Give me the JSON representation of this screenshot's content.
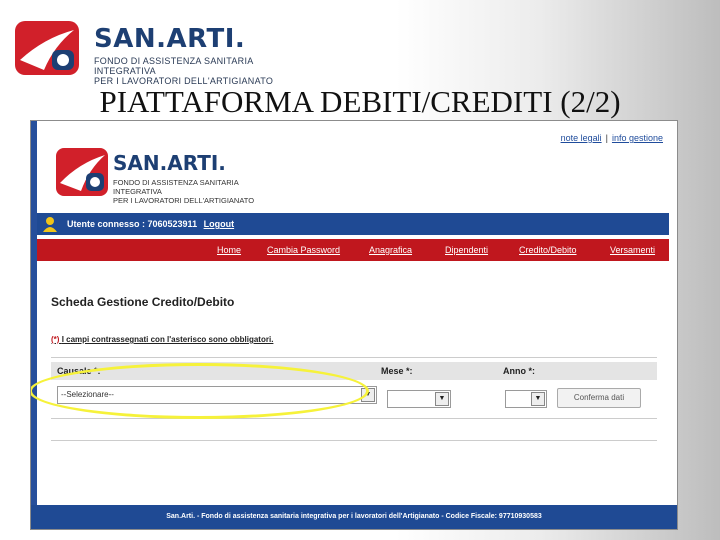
{
  "slide": {
    "brand": "SAN.ARTI.",
    "brand_sub_1": "FONDO DI ASSISTENZA SANITARIA INTEGRATIVA",
    "brand_sub_2": "PER I LAVORATORI DELL'ARTIGIANATO",
    "title": "PIATTAFORMA DEBITI/CREDITI (2/2)"
  },
  "app": {
    "toplinks": [
      "note legali",
      "info gestione"
    ],
    "brand": "SAN.ARTI.",
    "brand_sub_1": "FONDO DI ASSISTENZA SANITARIA INTEGRATIVA",
    "brand_sub_2": "PER I LAVORATORI DELL'ARTIGIANATO",
    "user_label": "Utente connesso : 7060523911",
    "logout": "Logout",
    "nav": [
      "Home",
      "Cambia Password",
      "Anagrafica",
      "Dipendenti",
      "Credito/Debito",
      "Versamenti"
    ],
    "form_title": "Scheda Gestione Credito/Debito",
    "required_star": "(*)",
    "required_text": "I campi contrassegnati con l'asterisco sono obbligatori.",
    "headers": {
      "causale": "Causale *:",
      "mese": "Mese *:",
      "anno": "Anno *:"
    },
    "causale_value": "--Selezionare--",
    "mese_value": "",
    "anno_value": "",
    "confirm_button": "Conferma dati",
    "footer": "San.Arti. - Fondo di assistenza sanitaria integrativa per i lavoratori dell'Artigianato - Codice Fiscale: 97710930583"
  },
  "colors": {
    "brand_blue": "#1f4a94",
    "nav_red": "#c0171e",
    "highlight": "#f6f23a"
  }
}
